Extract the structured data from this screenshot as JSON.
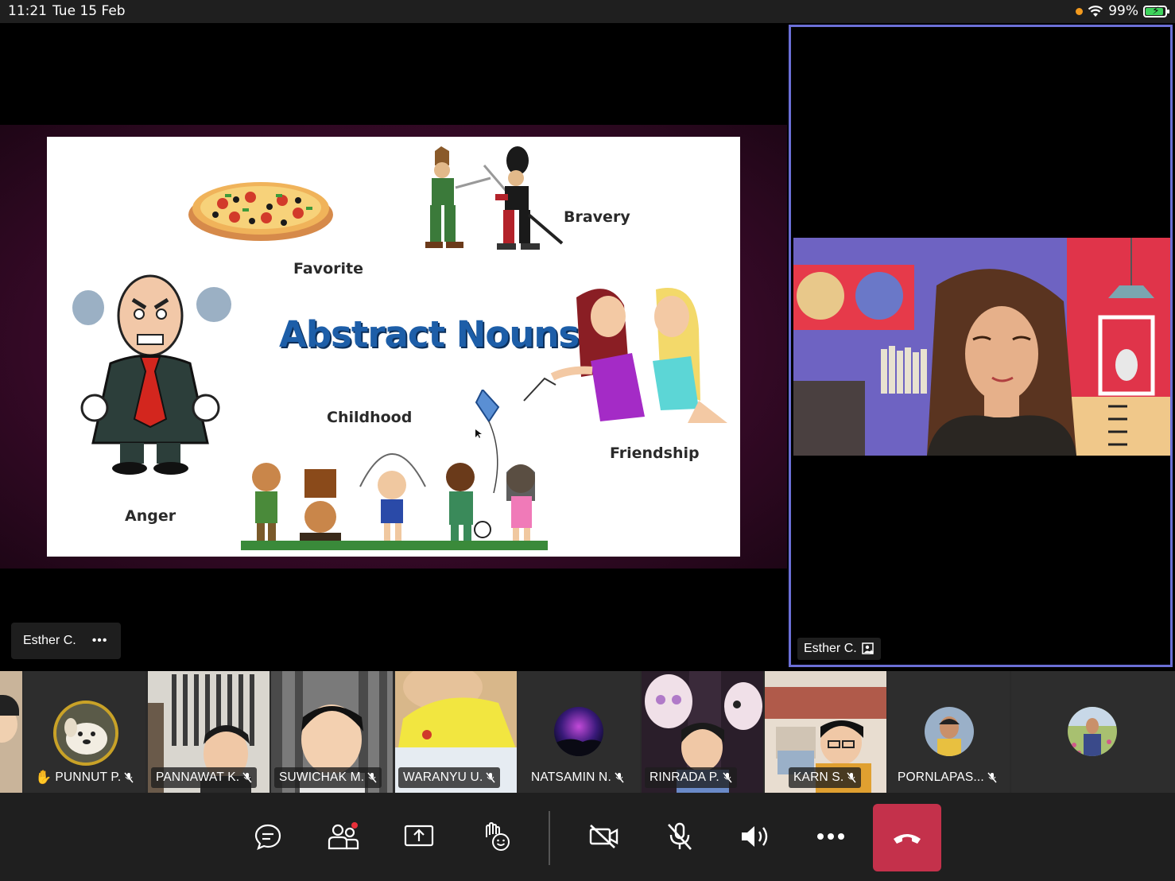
{
  "status_bar": {
    "time": "11:21",
    "date": "Tue 15 Feb",
    "battery": "99%"
  },
  "slide": {
    "title": "Abstract Nouns",
    "words": {
      "favorite": "Favorite",
      "bravery": "Bravery",
      "anger": "Anger",
      "childhood": "Childhood",
      "friendship": "Friendship"
    }
  },
  "presenter": {
    "name": "Esther C.",
    "more": "•••"
  },
  "camera": {
    "name": "Esther C."
  },
  "participants": [
    {
      "name": "PUNNUT P.",
      "hand_raised": true
    },
    {
      "name": "PANNAWAT K."
    },
    {
      "name": "SUWICHAK M."
    },
    {
      "name": "WARANYU U."
    },
    {
      "name": "NATSAMIN N."
    },
    {
      "name": "RINRADA P."
    },
    {
      "name": "KARN S."
    },
    {
      "name": "PORNLAPAS..."
    }
  ],
  "toolbar": {
    "icons": [
      "chat-icon",
      "participants-icon",
      "share-icon",
      "reactions-icon",
      "camera-off-icon",
      "mic-off-icon",
      "speaker-icon",
      "more-icon",
      "hangup-icon"
    ]
  },
  "colors": {
    "hangup": "#c4314b",
    "active_speaker_border": "#6b6fd6",
    "title": "#1d5ea8"
  }
}
